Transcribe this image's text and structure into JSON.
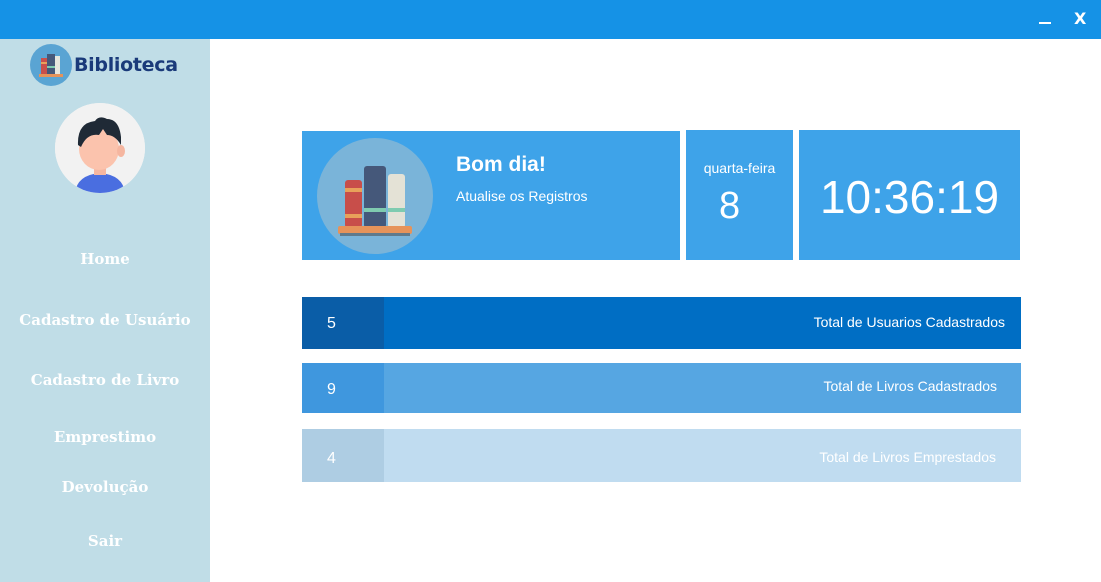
{
  "window": {
    "minimize_label": "—",
    "close_label": "X"
  },
  "brand": {
    "name": "Biblioteca"
  },
  "sidebar": {
    "items": [
      {
        "label": "Home"
      },
      {
        "label": "Cadastro de Usuário"
      },
      {
        "label": "Cadastro de Livro"
      },
      {
        "label": "Emprestimo"
      },
      {
        "label": "Devolução"
      },
      {
        "label": "Sair"
      }
    ]
  },
  "greeting": {
    "title": "Bom dia!",
    "subtitle": "Atualise os Registros"
  },
  "date": {
    "weekday": "quarta-feira",
    "day": "8"
  },
  "clock": {
    "time": "10:36:19"
  },
  "stats": [
    {
      "count": "5",
      "label": "Total de Usuarios Cadastrados"
    },
    {
      "count": "9",
      "label": "Total de Livros Cadastrados"
    },
    {
      "count": "4",
      "label": "Total de Livros Emprestados"
    }
  ],
  "colors": {
    "titlebar": "#1592e6",
    "sidebar": "#c0dde7",
    "card": "#3ea3e9",
    "stat_users": "#006ec4",
    "stat_books": "#56a6e2",
    "stat_loans": "#c0dcf0"
  }
}
